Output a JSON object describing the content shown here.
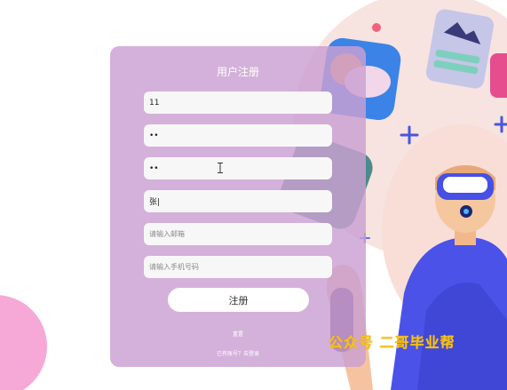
{
  "form": {
    "title": "用户注册",
    "username_value": "11",
    "password_value": "••",
    "confirm_value": "••",
    "name_value": "张|",
    "email_placeholder": "请输入邮箱",
    "phone_placeholder": "请输入手机号码",
    "submit_label": "注册",
    "reset_label": "重置",
    "login_link": "已有账号？去登录"
  },
  "watermark": "公众号 二哥毕业帮",
  "colors": {
    "panel": "#cba0d2",
    "accent_blue": "#4655e6",
    "watermark": "#f7c21a"
  }
}
